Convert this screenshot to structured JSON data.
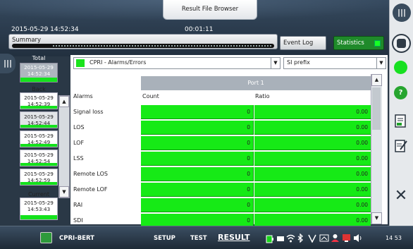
{
  "header": {
    "tab_label": "Result File Browser",
    "timestamp": "2015-05-29 14:52:34",
    "elapsed": "00:01:11",
    "summary_label": "Summary",
    "event_log_label": "Event Log",
    "statistics_label": "Statistics"
  },
  "time_panel": {
    "total_label": "Total",
    "total_value": "2015-05-29 14:52:34",
    "back_label": "Back",
    "current_label": "Current",
    "slots": [
      {
        "date": "2015-05-29",
        "time": "14:52:39"
      },
      {
        "date": "2015-05-29",
        "time": "14:52:44"
      },
      {
        "date": "2015-05-29",
        "time": "14:52:49"
      },
      {
        "date": "2015-05-29",
        "time": "14:52:54"
      },
      {
        "date": "2015-05-29",
        "time": "14:52:59"
      }
    ],
    "current_date": "2015-05-29",
    "current_time": "14:53:43"
  },
  "main": {
    "group_dropdown": "CPRI - Alarms/Errors",
    "prefix_dropdown": "SI prefix",
    "port_header": "Port 1",
    "col_alarms": "Alarms",
    "col_count": "Count",
    "col_ratio": "Ratio",
    "rows": [
      {
        "label": "Signal loss",
        "count": "0",
        "ratio": "0.00"
      },
      {
        "label": "LOS",
        "count": "0",
        "ratio": "0.00"
      },
      {
        "label": "LOF",
        "count": "0",
        "ratio": "0.00"
      },
      {
        "label": "LSS",
        "count": "0",
        "ratio": "0.00"
      },
      {
        "label": "Remote LOS",
        "count": "0",
        "ratio": "0.00"
      },
      {
        "label": "Remote LOF",
        "count": "0",
        "ratio": "0.00"
      },
      {
        "label": "RAI",
        "count": "0",
        "ratio": "0.00"
      },
      {
        "label": "SDI",
        "count": "0",
        "ratio": "0.00"
      }
    ]
  },
  "bottom": {
    "app_name": "CPRI-BERT",
    "setup": "SETUP",
    "test": "TEST",
    "result": "RESULT",
    "clock": "14 53"
  },
  "colors": {
    "status_green": "#16ea16",
    "accent_dark": "#2a3846",
    "statistics_active": "#1f8a2a"
  },
  "icons": [
    "grip-handle-icon",
    "record-stop-icon",
    "help-icon",
    "report-icon",
    "edit-report-icon",
    "close-icon",
    "app-icon",
    "battery-icon",
    "wifi-icon",
    "usb-icon",
    "volume-icon"
  ]
}
